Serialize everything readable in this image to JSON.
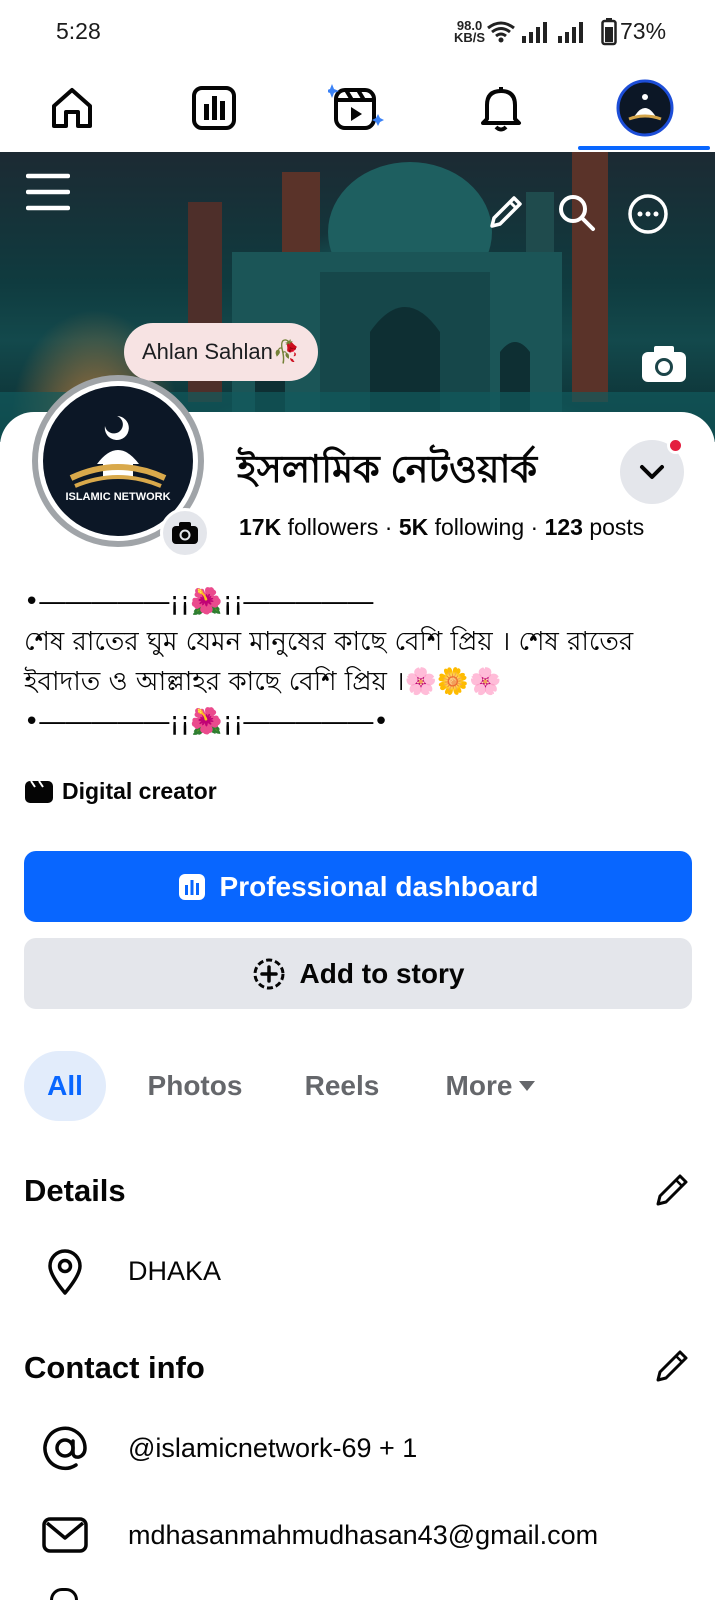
{
  "status_bar": {
    "time": "5:28",
    "net_speed_value": "98.0",
    "net_speed_unit": "KB/S",
    "battery": "73%"
  },
  "nav": {
    "items": [
      "home-icon",
      "dashboard-icon",
      "reels-icon",
      "notifications-icon",
      "profile-avatar"
    ],
    "active": "profile-avatar"
  },
  "cover": {
    "greeting": "Ahlan Sahlan🥀"
  },
  "profile": {
    "avatar_text": "ISLAMIC NETWORK",
    "name": "ইসলামিক নেটওয়ার্ক",
    "followers_count": "17K",
    "followers_label": "followers",
    "following_count": "5K",
    "following_label": "following",
    "posts_count": "123",
    "posts_label": "posts",
    "separator": "·",
    "bio_line1": "•―――――¡¡🌺¡¡―――――",
    "bio_line2": "শেষ রাতের ঘুম যেমন মানুষের কাছে বেশি প্রিয় । শেষ রাতের ইবাদাত ও আল্লাহর কাছে বেশি প্রিয় ।🌸🌼🌸",
    "bio_line3": "•―――――¡¡🌺¡¡―――――•",
    "category": "Digital creator"
  },
  "buttons": {
    "primary": "Professional dashboard",
    "secondary": "Add to story"
  },
  "tabs": [
    {
      "label": "All",
      "active": true
    },
    {
      "label": "Photos",
      "active": false
    },
    {
      "label": "Reels",
      "active": false
    },
    {
      "label": "More",
      "active": false
    }
  ],
  "details": {
    "title": "Details",
    "location": "DHAKA"
  },
  "contact": {
    "title": "Contact info",
    "username": "@islamicnetwork-69 + 1",
    "email": "mdhasanmahmudhasan43@gmail.com"
  },
  "colors": {
    "accent": "#0866ff",
    "secondary_bg": "#e4e6eb",
    "notification_dot": "#e41e3f"
  }
}
